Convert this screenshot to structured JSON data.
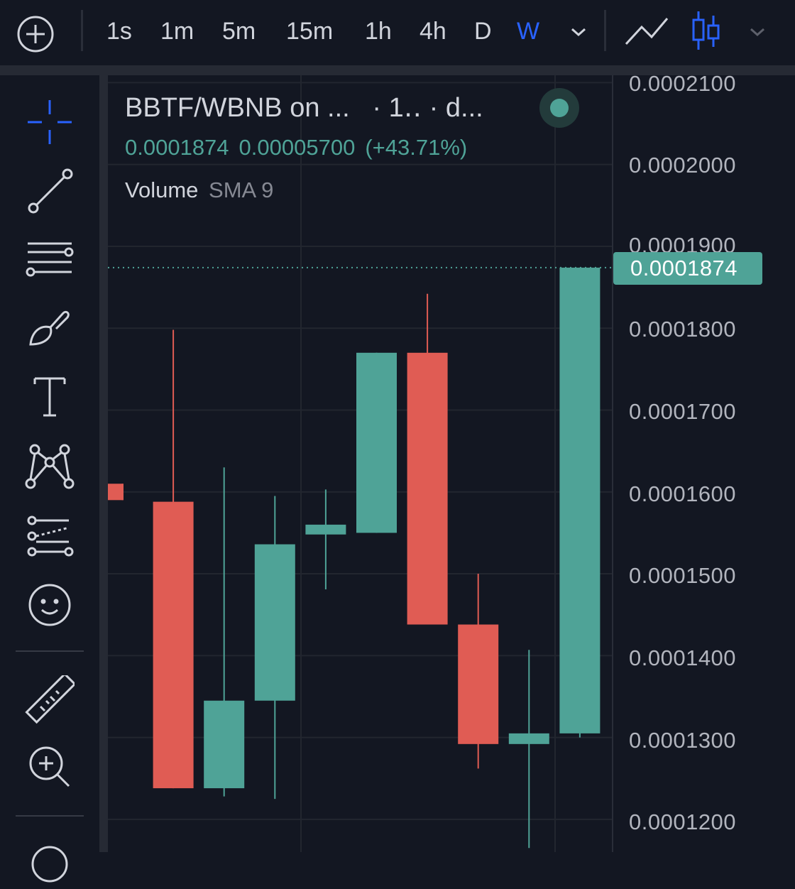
{
  "toolbar": {
    "timeframes": [
      "1s",
      "1m",
      "5m",
      "15m",
      "1h",
      "4h",
      "D",
      "W"
    ],
    "active_timeframe": "W"
  },
  "legend": {
    "title": "BBTF/WBNB on ...   · 1‥ · d...",
    "price": "0.0001874",
    "change": "0.00005700",
    "change_pct": "(+43.71%)",
    "indicator_name": "Volume",
    "indicator_params": "SMA 9"
  },
  "colors": {
    "up": "#4fa397",
    "down": "#e05c54",
    "accent": "#2962ff",
    "background": "#131722"
  },
  "price_axis": {
    "ticks": [
      "0.0002100",
      "0.0002000",
      "0.0001900",
      "0.0001800",
      "0.0001700",
      "0.0001600",
      "0.0001500",
      "0.0001400",
      "0.0001300",
      "0.0001200"
    ],
    "current_price": "0.0001874"
  },
  "chart_data": {
    "type": "candlestick",
    "symbol": "BBTF/WBNB",
    "interval": "W",
    "ylim": [
      0.000116,
      0.0002109
    ],
    "candles": [
      {
        "open": 0.000161,
        "high": 0.000161,
        "low": 0.000159,
        "close": 0.000159
      },
      {
        "open": 0.0001588,
        "high": 0.0001798,
        "low": 0.0001238,
        "close": 0.0001238
      },
      {
        "open": 0.0001238,
        "high": 0.000163,
        "low": 0.0001228,
        "close": 0.0001345
      },
      {
        "open": 0.0001345,
        "high": 0.0001595,
        "low": 0.0001225,
        "close": 0.0001536
      },
      {
        "open": 0.0001548,
        "high": 0.0001603,
        "low": 0.0001481,
        "close": 0.000156
      },
      {
        "open": 0.000155,
        "high": 0.000177,
        "low": 0.000155,
        "close": 0.000177
      },
      {
        "open": 0.000177,
        "high": 0.0001842,
        "low": 0.0001438,
        "close": 0.0001438
      },
      {
        "open": 0.0001438,
        "high": 0.00015,
        "low": 0.0001262,
        "close": 0.0001292
      },
      {
        "open": 0.0001292,
        "high": 0.0001407,
        "low": 0.0001165,
        "close": 0.0001305
      },
      {
        "open": 0.0001305,
        "high": 0.0001874,
        "low": 0.00013,
        "close": 0.0001874
      }
    ]
  }
}
